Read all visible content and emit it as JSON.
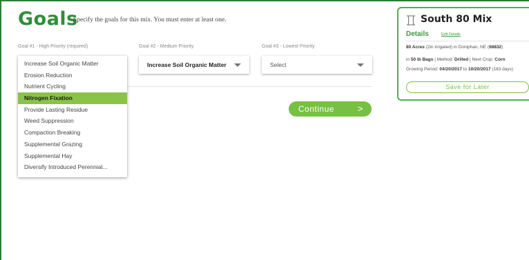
{
  "header": {
    "title": "Goals",
    "subtitle": "Specify the goals for this mix. You must enter at least one."
  },
  "goals": [
    {
      "label": "Goal #1 - High Priority (required)",
      "value": "Increase Soil Organic Matter"
    },
    {
      "label": "Goal #2 - Medium Priority",
      "value": "Increase Soil Organic Matter"
    },
    {
      "label": "Goal #3 - Lowest Priority",
      "value": "Select"
    }
  ],
  "dropdown": {
    "options": [
      "Increase Soil Organic Matter",
      "Erosion Reduction",
      "Nutrient Cycling",
      "Nitrogen Fixation",
      "Provide Lasting Residue",
      "Weed Suppression",
      "Compaction Breaking",
      "Supplemental Grazing",
      "Supplemental Hay",
      "Diversify Introduced Perennial..."
    ],
    "highlighted": "Nitrogen Fixation"
  },
  "actions": {
    "continue_label": "Continue",
    "continue_arrow": ">"
  },
  "mix": {
    "title": "South 80 Mix",
    "details_label": "Details",
    "edit_link": "Edit Details",
    "acres": "80 Acres",
    "irrigation": "(2in irrigated) in Doniphan, NE (",
    "zip": "68832",
    "zip_close": ")",
    "bag_prefix": "in ",
    "bags": "50 lb Bags",
    "method_label": " | Method: ",
    "method": "Drilled",
    "next_crop_label": " | Next Crop: ",
    "next_crop": "Corn",
    "growing_label": "Growing Period: ",
    "start_date": "04/20/2017",
    "to_label": " to ",
    "end_date": "10/20/2017",
    "duration": " (183 days)",
    "save_label": "Save for Later"
  },
  "colors": {
    "brand_green": "#2f8f3a",
    "accent_green": "#76c043",
    "highlight_green": "#8bc34a",
    "border_green": "#4caf50"
  },
  "icons": {
    "mix_icon": "mix-bag-icon",
    "caret": "chevron-down-icon",
    "continue_arrow": "chevron-right-icon"
  }
}
